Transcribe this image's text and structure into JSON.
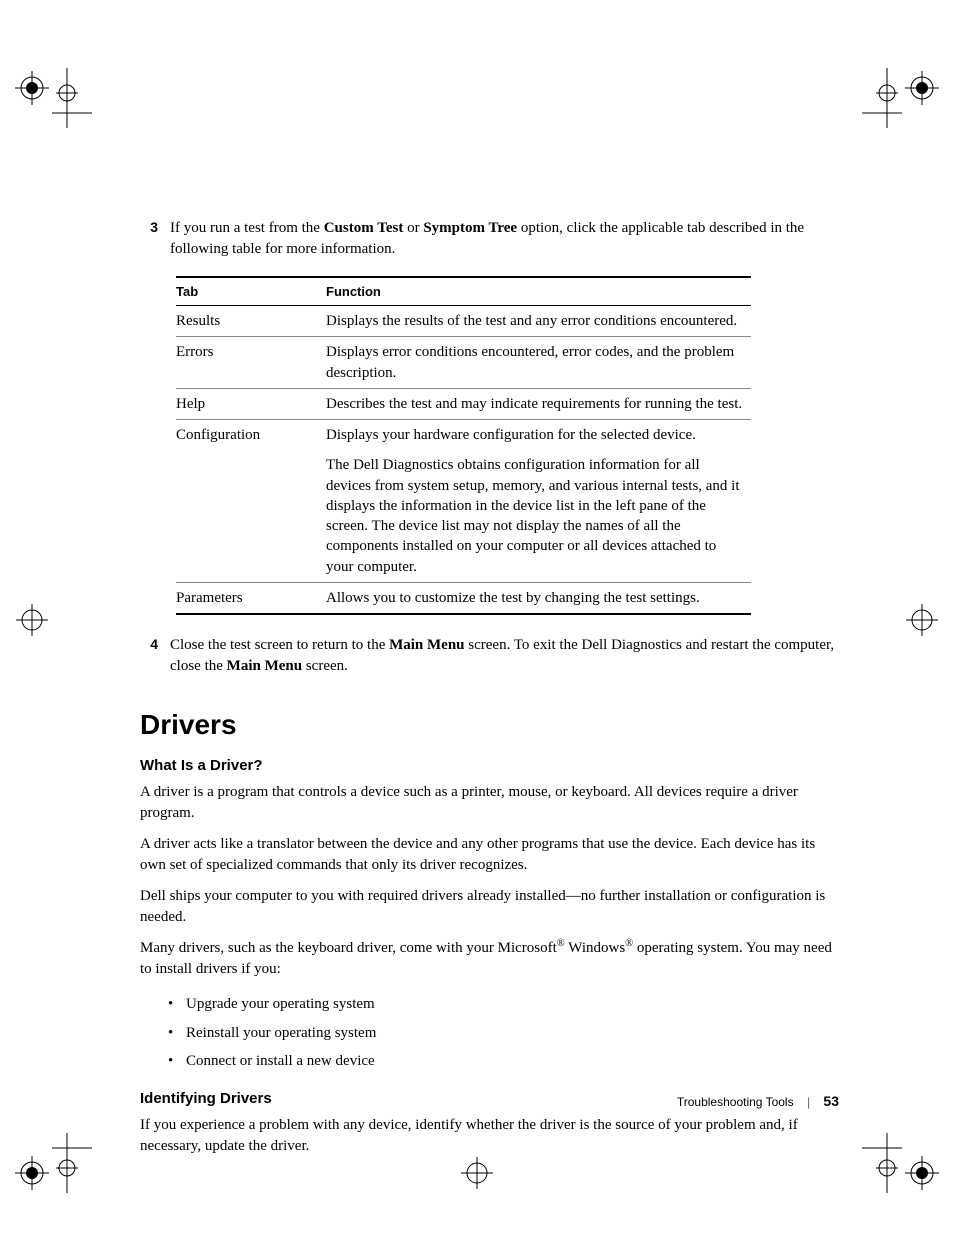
{
  "step3": {
    "num": "3",
    "pre": "If you run a test from the ",
    "bold1": "Custom Test",
    "mid": " or ",
    "bold2": "Symptom Tree",
    "post": " option, click the applicable tab described in the following table for more information."
  },
  "table": {
    "head": {
      "c1": "Tab",
      "c2": "Function"
    },
    "rows": [
      {
        "c1": "Results",
        "c2": "Displays the results of the test and any error conditions encountered."
      },
      {
        "c1": "Errors",
        "c2": "Displays error conditions encountered, error codes, and the problem description."
      },
      {
        "c1": "Help",
        "c2": "Describes the test and may indicate requirements for running the test."
      },
      {
        "c1": "Configuration",
        "c2a": "Displays your hardware configuration for the selected device.",
        "c2b": "The Dell Diagnostics obtains configuration information for all devices from system setup, memory, and various internal tests, and it displays the information in the device list in the left pane of the screen. The device list may not display the names of all the components installed on your computer or all devices attached to your computer."
      },
      {
        "c1": "Parameters",
        "c2": "Allows you to customize the test by changing the test settings."
      }
    ]
  },
  "step4": {
    "num": "4",
    "pre": "Close the test screen to return to the ",
    "bold1": "Main Menu",
    "mid": " screen. To exit the Dell Diagnostics and restart the computer, close the ",
    "bold2": "Main Menu",
    "post": " screen."
  },
  "heading": "Drivers",
  "sub1": "What Is a Driver?",
  "p1": "A driver is a program that controls a device such as a printer, mouse, or keyboard. All devices require a driver program.",
  "p2": "A driver acts like a translator between the device and any other programs that use the device. Each device has its own set of specialized commands that only its driver recognizes.",
  "p3": "Dell ships your computer to you with required drivers already installed—no further installation or configuration is needed.",
  "p4": {
    "pre": "Many drivers, such as the keyboard driver, come with your Microsoft",
    "reg1": "®",
    "mid": " Windows",
    "reg2": "®",
    "post": " operating system. You may need to install drivers if you:"
  },
  "bullets": [
    "Upgrade your operating system",
    "Reinstall your operating system",
    "Connect or install a new device"
  ],
  "sub2": "Identifying Drivers",
  "p5": "If you experience a problem with any device, identify whether the driver is the source of your problem and, if necessary, update the driver.",
  "footer": {
    "section": "Troubleshooting Tools",
    "page": "53"
  }
}
